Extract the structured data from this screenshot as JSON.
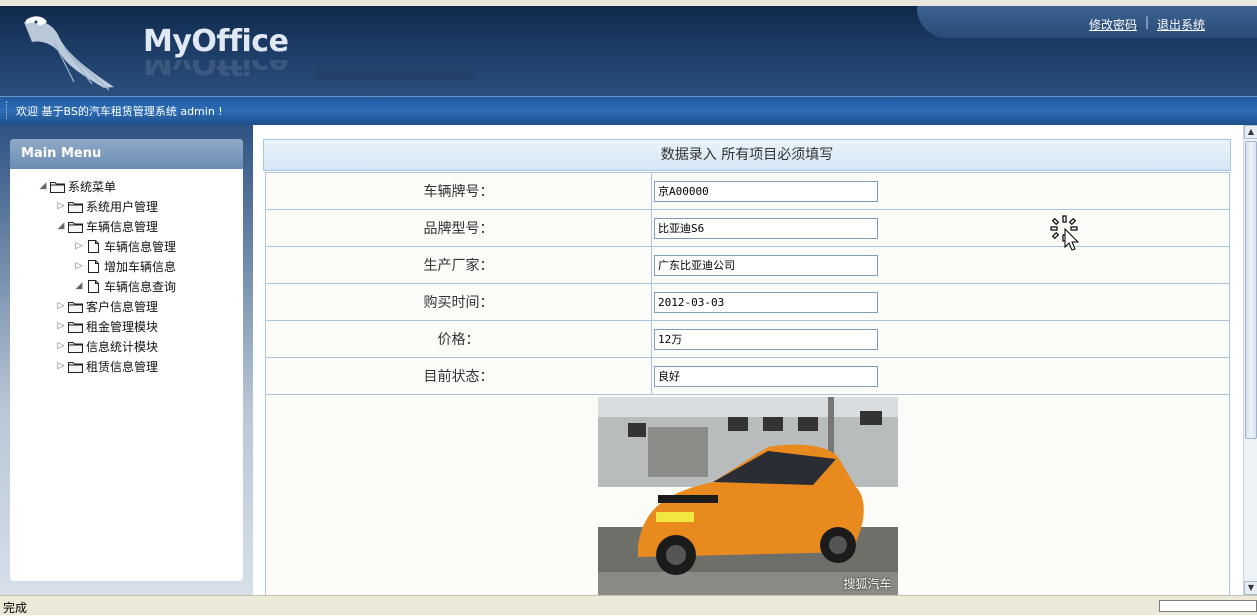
{
  "header": {
    "app_name": "MyOffice",
    "links": {
      "change_password": "修改密码",
      "logout": "退出系统",
      "separator": "|"
    }
  },
  "welcome": {
    "text": "欢迎 基于BS的汽车租赁管理系统 admin !"
  },
  "sidebar": {
    "title": "Main Menu",
    "tree": [
      {
        "label": "系统菜单",
        "arrow": "◢",
        "icon": "folder-icon"
      },
      {
        "label": "系统用户管理",
        "arrow": "▷",
        "icon": "folder-icon"
      },
      {
        "label": "车辆信息管理",
        "arrow": "◢",
        "icon": "folder-icon"
      },
      {
        "label": "车辆信息管理",
        "arrow": "▷",
        "icon": "document-icon"
      },
      {
        "label": "增加车辆信息",
        "arrow": "▷",
        "icon": "document-icon"
      },
      {
        "label": "车辆信息查询",
        "arrow": "◢",
        "icon": "document-icon"
      },
      {
        "label": "客户信息管理",
        "arrow": "▷",
        "icon": "folder-icon"
      },
      {
        "label": "租金管理模块",
        "arrow": "▷",
        "icon": "folder-icon"
      },
      {
        "label": "信息统计模块",
        "arrow": "▷",
        "icon": "folder-icon"
      },
      {
        "label": "租赁信息管理",
        "arrow": "▷",
        "icon": "folder-icon"
      }
    ]
  },
  "form": {
    "title": "数据录入 所有项目必须填写",
    "fields": [
      {
        "label": "车辆牌号：",
        "value": "京A00000"
      },
      {
        "label": "品牌型号：",
        "value": "比亚迪S6"
      },
      {
        "label": "生产厂家：",
        "value": "广东比亚迪公司"
      },
      {
        "label": "购买时间：",
        "value": "2012-03-03"
      },
      {
        "label": "价格：",
        "value": "12万"
      },
      {
        "label": "目前状态：",
        "value": "良好"
      }
    ],
    "photo_caption": "搜狐汽车"
  },
  "status": {
    "text": "完成"
  },
  "colors": {
    "header_dark": "#0f2747",
    "welcome_bar": "#2d6db5",
    "border": "#a9c5e0"
  }
}
